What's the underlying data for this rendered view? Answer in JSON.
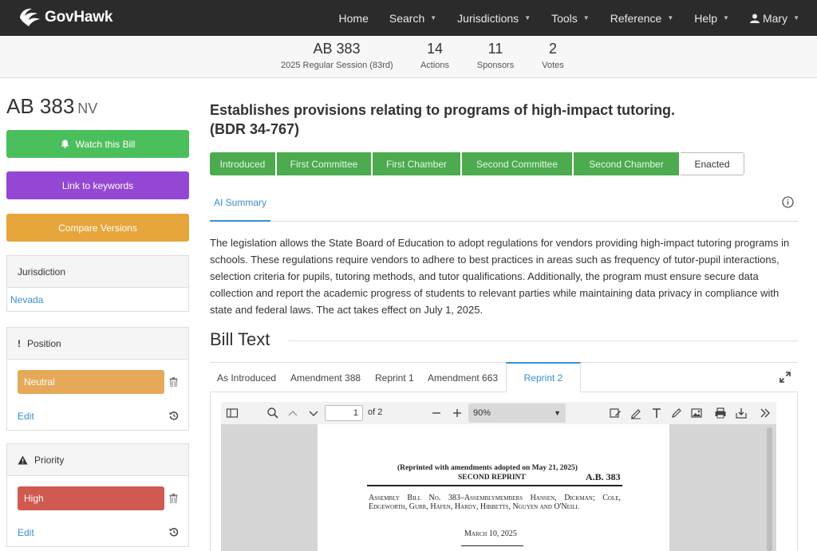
{
  "brand": {
    "name": "GovHawk"
  },
  "nav": {
    "items": [
      {
        "label": "Home",
        "caret": false
      },
      {
        "label": "Search",
        "caret": true
      },
      {
        "label": "Jurisdictions",
        "caret": true
      },
      {
        "label": "Tools",
        "caret": true
      },
      {
        "label": "Reference",
        "caret": true
      },
      {
        "label": "Help",
        "caret": true
      }
    ],
    "user": "Mary"
  },
  "stats": {
    "bill": "AB 383",
    "session": "2025 Regular Session (83rd)",
    "actions_count": "14",
    "actions_label": "Actions",
    "sponsors_count": "11",
    "sponsors_label": "Sponsors",
    "votes_count": "2",
    "votes_label": "Votes"
  },
  "sidebar": {
    "bill_id": "AB 383",
    "state": "NV",
    "watch_label": "Watch this Bill",
    "keywords_label": "Link to keywords",
    "compare_label": "Compare Versions",
    "jurisdiction": {
      "heading": "Jurisdiction",
      "value": "Nevada"
    },
    "position": {
      "heading": "Position",
      "value": "Neutral",
      "edit_label": "Edit"
    },
    "priority": {
      "heading": "Priority",
      "value": "High",
      "edit_label": "Edit"
    }
  },
  "main": {
    "title_line1": "Establishes provisions relating to programs of high-impact tutoring.",
    "title_line2": "(BDR 34-767)",
    "stages": [
      "Introduced",
      "First Committee",
      "First Chamber",
      "Second Committee",
      "Second Chamber",
      "Enacted"
    ],
    "tab_ai": "AI Summary",
    "summary": "The legislation allows the State Board of Education to adopt regulations for vendors providing high-impact tutoring programs in schools. These regulations require vendors to adhere to best practices in areas such as frequency of tutor-pupil interactions, selection criteria for pupils, tutoring methods, and tutor qualifications. Additionally, the program must ensure secure data collection and report the academic progress of students to relevant parties while maintaining data privacy in compliance with state and federal laws. The act takes effect on July 1, 2025.",
    "bill_text_heading": "Bill Text",
    "version_tabs": [
      "As Introduced",
      "Amendment 388",
      "Reprint 1",
      "Amendment 663",
      "Reprint 2"
    ]
  },
  "pdf": {
    "page": "1",
    "of_pages": "of 2",
    "zoom": "90%",
    "reprint_note": "(Reprinted with amendments adopted on May 21, 2025)",
    "second_reprint": "SECOND REPRINT",
    "ab_label": "A.B. 383",
    "assembly_text": "Assembly Bill No. 383–Assemblymembers Hansen, Dickman; Cole, Edgeworth, Gurr, Hafen, Hardy, Hibbetts, Nguyen and O'Neill",
    "date": "March 10, 2025"
  },
  "colors": {
    "green": "#4cbf5d",
    "purple": "#9447d4",
    "orange": "#e6a63c",
    "link": "#3a8fcf",
    "neutral": "#e6a959",
    "high": "#d05a4f"
  }
}
